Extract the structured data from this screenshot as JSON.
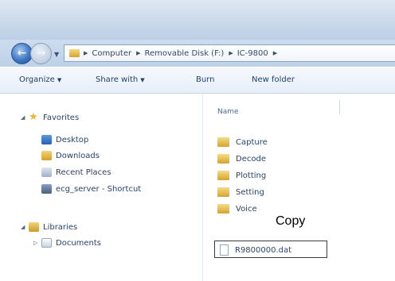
{
  "address": {
    "crumbs": [
      "Computer",
      "Removable Disk (F:)",
      "IC-9800",
      "▸"
    ]
  },
  "toolbar": {
    "organize": "Organize",
    "share_with": "Share with",
    "burn": "Burn",
    "new_folder": "New folder"
  },
  "nav": {
    "favorites": "Favorites",
    "desktop": "Desktop",
    "downloads": "Downloads",
    "recent_places": "Recent Places",
    "shortcut": "ecg_server - Shortcut",
    "libraries": "Libraries",
    "documents": "Documents"
  },
  "content": {
    "column_name": "Name",
    "folders": [
      "Capture",
      "Decode",
      "Plotting",
      "Setting",
      "Voice"
    ],
    "file": "R9800000.dat",
    "annotation": "Copy"
  },
  "colors": {
    "accent": "#3f78c2",
    "folder": "#e6b43c"
  }
}
